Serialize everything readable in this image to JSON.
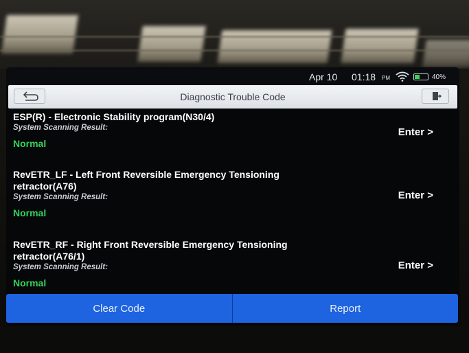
{
  "status_bar": {
    "date": "Apr 10",
    "time": "01:18",
    "ampm": "PM",
    "battery": "40%",
    "battery_level": 0.4,
    "wifi_icon": "wifi-icon"
  },
  "header": {
    "title": "Diagnostic Trouble Code",
    "back_icon": "back-arrow-icon",
    "exit_icon": "exit-door-icon"
  },
  "systems": [
    {
      "title": "ESP(R) - Electronic Stability program(N30/4)",
      "subtitle": "System Scanning Result:",
      "status": "Normal",
      "action": "Enter >"
    },
    {
      "title": "RevETR_LF - Left Front Reversible Emergency Tensioning retractor(A76)",
      "subtitle": "System Scanning Result:",
      "status": "Normal",
      "action": "Enter >"
    },
    {
      "title": "RevETR_RF - Right Front Reversible Emergency Tensioning retractor(A76/1)",
      "subtitle": "System Scanning Result:",
      "status": "Normal",
      "action": "Enter >"
    }
  ],
  "footer": {
    "clear_label": "Clear Code",
    "report_label": "Report"
  },
  "colors": {
    "accent": "#1e63e0",
    "normal": "#33d35a",
    "title_bar": "#e6e9ed"
  }
}
